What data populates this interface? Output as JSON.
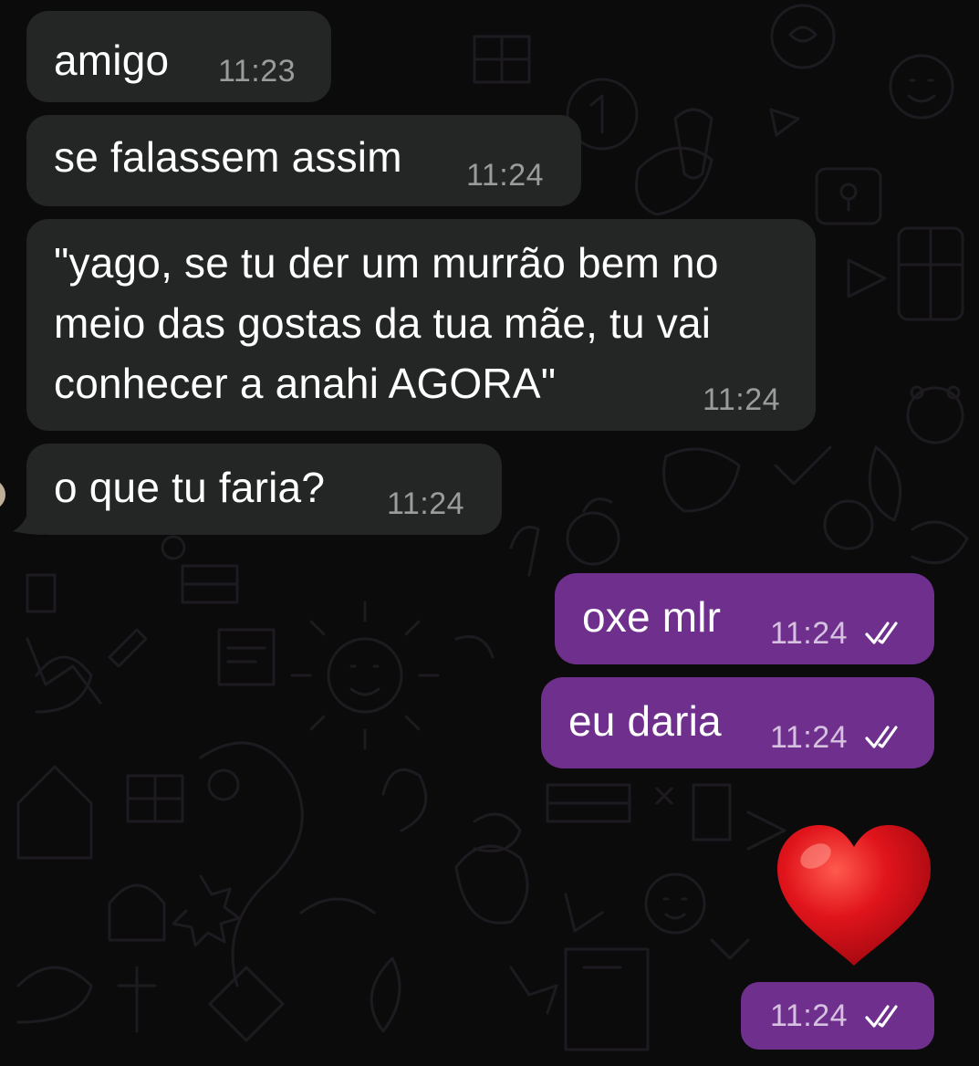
{
  "chat": {
    "messages": [
      {
        "direction": "incoming",
        "text": "amigo",
        "time": "11:23"
      },
      {
        "direction": "incoming",
        "text": "se falassem assim",
        "time": "11:24"
      },
      {
        "direction": "incoming",
        "lines": [
          "\"yago, se tu der um murrão bem no",
          "meio das gostas da tua mãe, tu vai",
          "conhecer a anahi AGORA\""
        ],
        "time": "11:24"
      },
      {
        "direction": "incoming",
        "text": "o que tu faria?",
        "time": "11:24"
      },
      {
        "direction": "outgoing",
        "text": "oxe mlr",
        "time": "11:24",
        "status": "read"
      },
      {
        "direction": "outgoing",
        "text": "eu daria",
        "time": "11:24",
        "status": "read"
      },
      {
        "direction": "outgoing",
        "emoji": "red-heart",
        "time": "11:24",
        "status": "read"
      }
    ]
  },
  "colors": {
    "background": "#0b0b0c",
    "incoming_bubble": "#242626",
    "outgoing_bubble": "#6f2f8c",
    "heart": "#e0141b"
  }
}
